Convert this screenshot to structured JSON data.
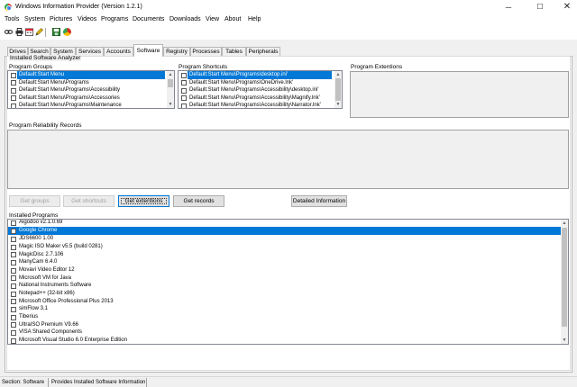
{
  "window": {
    "title": "Windows Information Provider (Version 1.2.1)",
    "minimize": "─",
    "maximize": "☐",
    "close": "✕"
  },
  "menu": [
    "Tools",
    "System",
    "Pictures",
    "Videos",
    "Programs",
    "Documents",
    "Downloads",
    "View",
    "About",
    "Help"
  ],
  "toolbar": {
    "icons": [
      "link-icon",
      "printer-icon",
      "calendar-icon",
      "pencil-icon",
      "save-icon",
      "chrome-icon"
    ]
  },
  "tabs": [
    "Drives",
    "Search",
    "System",
    "Services",
    "Accounts",
    "Software",
    "Registry",
    "Processes",
    "Tables",
    "Peripherals"
  ],
  "active_tab": "Software",
  "panel": {
    "title": "Installed Software Analyzer",
    "program_groups": {
      "label": "Program Groups",
      "items": [
        "Default:Start Menu",
        "Default:Start Menu\\Programs",
        "Default:Start Menu\\Programs\\Accessibility",
        "Default:Start Menu\\Programs\\Accessories",
        "Default:Start Menu\\Programs\\Maintenance"
      ],
      "selected": 0
    },
    "program_shortcuts": {
      "label": "Program Shortcuts",
      "items": [
        "Default:Start Menu\\Programs\\desktop.ini'",
        "Default:Start Menu\\Programs\\OneDrive.lnk'",
        "Default:Start Menu\\Programs\\Accessibility\\desktop.ini'",
        "Default:Start Menu\\Programs\\Accessibility\\Magnify.lnk'",
        "Default:Start Menu\\Programs\\Accessibility\\Narrator.lnk'"
      ],
      "selected": 0
    },
    "program_extensions": {
      "label": "Program Extentions"
    },
    "reliability": {
      "label": "Program Reliability Records"
    },
    "buttons": {
      "get_groups": "Get groups",
      "get_shortcuts": "Get shortcuts",
      "get_extensions": "Get extentions",
      "get_records": "Get records",
      "detailed_info": "Detailed Information"
    },
    "installed_programs": {
      "label": "Installed Programs",
      "items": [
        "Algodoo v2.1.0.69",
        "Google Chrome",
        "JDS6600 1.00",
        "Magic ISO Maker v5.5 (build 0281)",
        "MagicDisc 2.7.106",
        "ManyCam 6.4.0",
        "Movavi Video Editor 12",
        "Microsoft VM for Java",
        "National Instruments Software",
        "Notepad++ (32-bit x86)",
        "Microsoft Office Professional Plus 2013",
        "simFlow 3.1",
        "Tiberius",
        "UltraISO Premium V9.66",
        "VISA Shared Components",
        "Microsoft Visual Studio 6.0 Enterprise Edition"
      ],
      "selected": 1
    }
  },
  "status": {
    "section": "Section: Software",
    "description": "Provides Installed Software Information"
  }
}
